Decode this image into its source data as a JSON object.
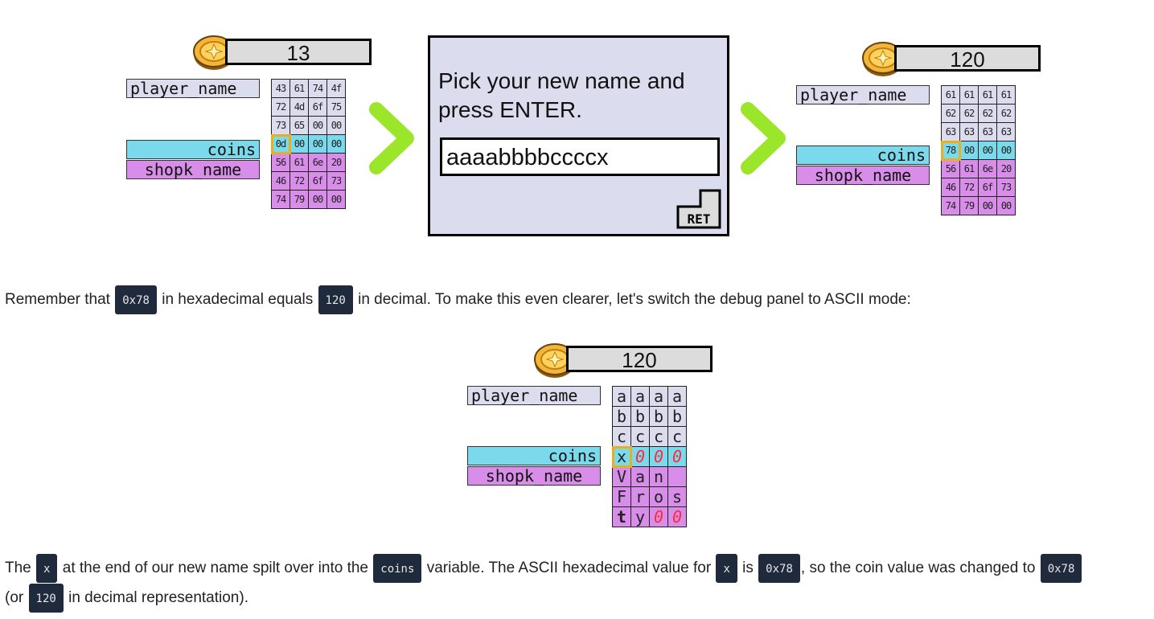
{
  "panel_before": {
    "coins_display": "13",
    "labels": {
      "player_name": "player_name",
      "coins": "coins",
      "shopk_name": "shopk_name"
    },
    "rows": [
      {
        "kind": "player",
        "cells": [
          "43",
          "61",
          "74",
          "4f"
        ]
      },
      {
        "kind": "player",
        "cells": [
          "72",
          "4d",
          "6f",
          "75"
        ]
      },
      {
        "kind": "player",
        "cells": [
          "73",
          "65",
          "00",
          "00"
        ]
      },
      {
        "kind": "coins",
        "cells": [
          "0d",
          "00",
          "00",
          "00"
        ]
      },
      {
        "kind": "shopk",
        "cells": [
          "56",
          "61",
          "6e",
          "20"
        ]
      },
      {
        "kind": "shopk",
        "cells": [
          "46",
          "72",
          "6f",
          "73"
        ]
      },
      {
        "kind": "shopk",
        "cells": [
          "74",
          "79",
          "00",
          "00"
        ]
      }
    ]
  },
  "dialog": {
    "prompt_line1": "Pick your new name and",
    "prompt_line2": "press ENTER.",
    "name_value": "aaaabbbbccccx",
    "return_key_label": "RET"
  },
  "panel_after": {
    "coins_display": "120",
    "labels": {
      "player_name": "player_name",
      "coins": "coins",
      "shopk_name": "shopk_name"
    },
    "rows": [
      {
        "kind": "player",
        "cells": [
          "61",
          "61",
          "61",
          "61"
        ]
      },
      {
        "kind": "player",
        "cells": [
          "62",
          "62",
          "62",
          "62"
        ]
      },
      {
        "kind": "player",
        "cells": [
          "63",
          "63",
          "63",
          "63"
        ]
      },
      {
        "kind": "coins",
        "cells": [
          "78",
          "00",
          "00",
          "00"
        ]
      },
      {
        "kind": "shopk",
        "cells": [
          "56",
          "61",
          "6e",
          "20"
        ]
      },
      {
        "kind": "shopk",
        "cells": [
          "46",
          "72",
          "6f",
          "73"
        ]
      },
      {
        "kind": "shopk",
        "cells": [
          "74",
          "79",
          "00",
          "00"
        ]
      }
    ]
  },
  "panel_ascii": {
    "coins_display": "120",
    "labels": {
      "player_name": "player_name",
      "coins": "coins",
      "shopk_name": "shopk_name"
    },
    "rows": [
      {
        "kind": "player",
        "cells": [
          "a",
          "a",
          "a",
          "a"
        ]
      },
      {
        "kind": "player",
        "cells": [
          "b",
          "b",
          "b",
          "b"
        ]
      },
      {
        "kind": "player",
        "cells": [
          "c",
          "c",
          "c",
          "c"
        ]
      },
      {
        "kind": "coins",
        "cells": [
          "x",
          "0",
          "0",
          "0"
        ],
        "null_cells": [
          1,
          2,
          3
        ]
      },
      {
        "kind": "shopk",
        "cells": [
          "V",
          "a",
          "n",
          ""
        ]
      },
      {
        "kind": "shopk",
        "cells": [
          "F",
          "r",
          "o",
          "s"
        ]
      },
      {
        "kind": "shopk",
        "cells": [
          "t",
          "y",
          "0",
          "0"
        ],
        "null_cells": [
          2,
          3
        ]
      }
    ]
  },
  "paragraph1": {
    "t1": "Remember that",
    "c1": "0x78",
    "t2": "in hexadecimal equals",
    "c2": "120",
    "t3": "in decimal. To make this even clearer, let's switch the debug panel to ASCII mode:"
  },
  "paragraph2": {
    "t1": "The",
    "c1": "x",
    "t2": "at the end of our new name spilt over into the",
    "c2": "coins",
    "t3": "variable. The ASCII hexadecimal value for",
    "c3": "x",
    "t4": "is",
    "c4": "0x78",
    "t5": ", so the coin value was changed to",
    "c5": "0x78",
    "t6": "(or",
    "c6": "120",
    "t7": "in decimal representation)."
  },
  "colors": {
    "player_bg": "#dcdcef",
    "coins_bg": "#7ad9ea",
    "shopk_bg": "#d88de8",
    "selection": "#e8b020",
    "null_byte": "#ff2a3a",
    "arrow": "#9be52a",
    "code_bg": "#1f2a3c"
  }
}
